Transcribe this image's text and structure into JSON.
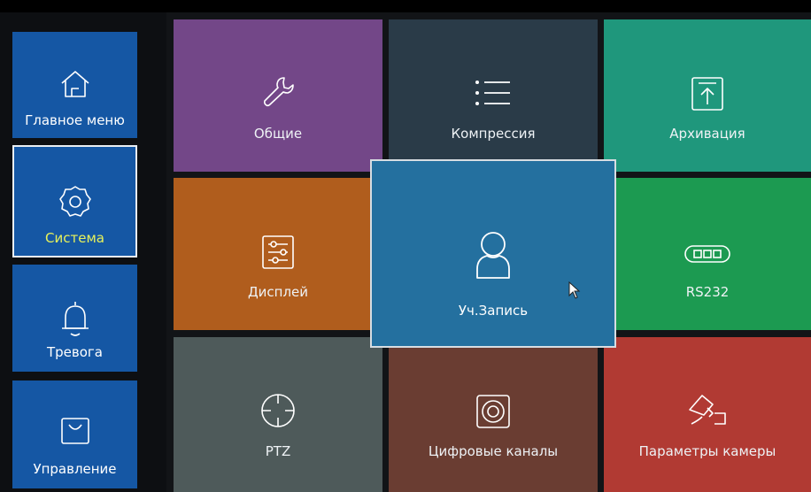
{
  "sidebar": {
    "items": [
      {
        "label": "Главное меню",
        "icon": "home-icon"
      },
      {
        "label": "Система",
        "icon": "gear-icon",
        "selected": true
      },
      {
        "label": "Тревога",
        "icon": "bell-icon"
      },
      {
        "label": "Управление",
        "icon": "shopping-bag-icon"
      }
    ]
  },
  "tiles": {
    "general": {
      "label": "Общие",
      "icon": "wrench-icon",
      "color": "#734788"
    },
    "compression": {
      "label": "Компрессия",
      "icon": "list-icon",
      "color": "#2a3b48"
    },
    "archive": {
      "label": "Архивация",
      "icon": "upload-icon",
      "color": "#1f977c"
    },
    "display": {
      "label": "Дисплей",
      "icon": "sliders-icon",
      "color": "#b05d1d"
    },
    "account": {
      "label": "Уч.Запись",
      "icon": "user-icon",
      "color": "#24709f"
    },
    "rs232": {
      "label": "RS232",
      "icon": "serial-port-icon",
      "color": "#1c9a51"
    },
    "ptz": {
      "label": "PTZ",
      "icon": "crosshair-icon",
      "color": "#4e5a5a"
    },
    "digital": {
      "label": "Цифровые каналы",
      "icon": "speaker-icon",
      "color": "#6a3d32"
    },
    "camera": {
      "label": "Параметры камеры",
      "icon": "camera-icon",
      "color": "#b13a33"
    }
  }
}
